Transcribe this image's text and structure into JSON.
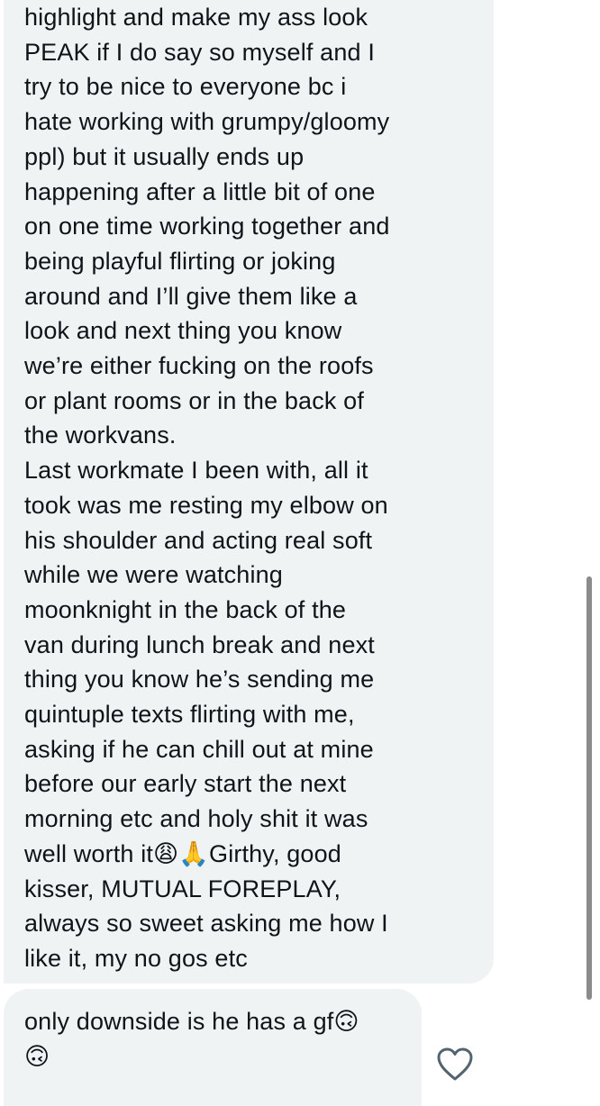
{
  "messages": [
    {
      "text": "highlight and make my ass look\nPEAK if I do say so myself and I\ntry to be nice to everyone bc i\nhate working with grumpy/gloomy\nppl) but it usually ends up\nhappening after a little bit of one\non one time working together and\nbeing playful flirting or joking\naround and I’ll give them like a\nlook and next thing you know\nwe’re either fucking on the roofs\nor plant rooms or in the back of\nthe workvans.\nLast workmate I been with, all it\ntook was me resting my elbow on\nhis shoulder and acting real soft\nwhile we were watching\nmoonknight in the back of the\nvan during lunch break and next\nthing you know he’s sending me\nquintuple texts flirting with me,\nasking if he can chill out at mine\nbefore our early start the next\nmorning etc and holy shit it was\nwell worth it😩🙏Girthy, good\nkisser, MUTUAL FOREPLAY,\nalways so sweet asking me how I\nlike it, my no gos etc"
    },
    {
      "text": "only downside is he has a gf🙃\n🙃"
    }
  ],
  "reaction": {
    "icon": "heart-outline-icon"
  },
  "colors": {
    "bubble": "#eff3f4",
    "text": "#0f1419",
    "scrollbar": "#8b8b8b"
  }
}
